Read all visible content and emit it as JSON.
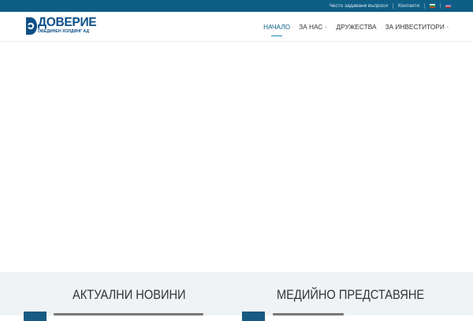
{
  "topbar": {
    "links": [
      "Често задавани въпроси",
      "Контакти"
    ],
    "languages": [
      "bg-flag-icon",
      "en-flag-icon"
    ]
  },
  "brand": {
    "title": "ДОВЕРИЕ",
    "subtitle": "ОБЕДИНЕН ХОЛДИНГ АД",
    "color": "#0d4f86"
  },
  "nav": {
    "items": [
      {
        "label": "НАЧАЛО",
        "active": true,
        "dropdown": false
      },
      {
        "label": "ЗА НАС",
        "active": false,
        "dropdown": true
      },
      {
        "label": "ДРУЖЕСТВА",
        "active": false,
        "dropdown": false
      },
      {
        "label": "ЗА ИНВЕСТИТОРИ",
        "active": false,
        "dropdown": true
      }
    ],
    "caret": "⌄"
  },
  "sections": {
    "news_title": "АКТУАЛНИ НОВИНИ",
    "media_title": "МЕДИЙНО ПРЕДСТАВЯНЕ"
  },
  "colors": {
    "topbar": "#0e5e86",
    "accent": "#1e8dbd",
    "lower_bg": "#eff3f6"
  }
}
